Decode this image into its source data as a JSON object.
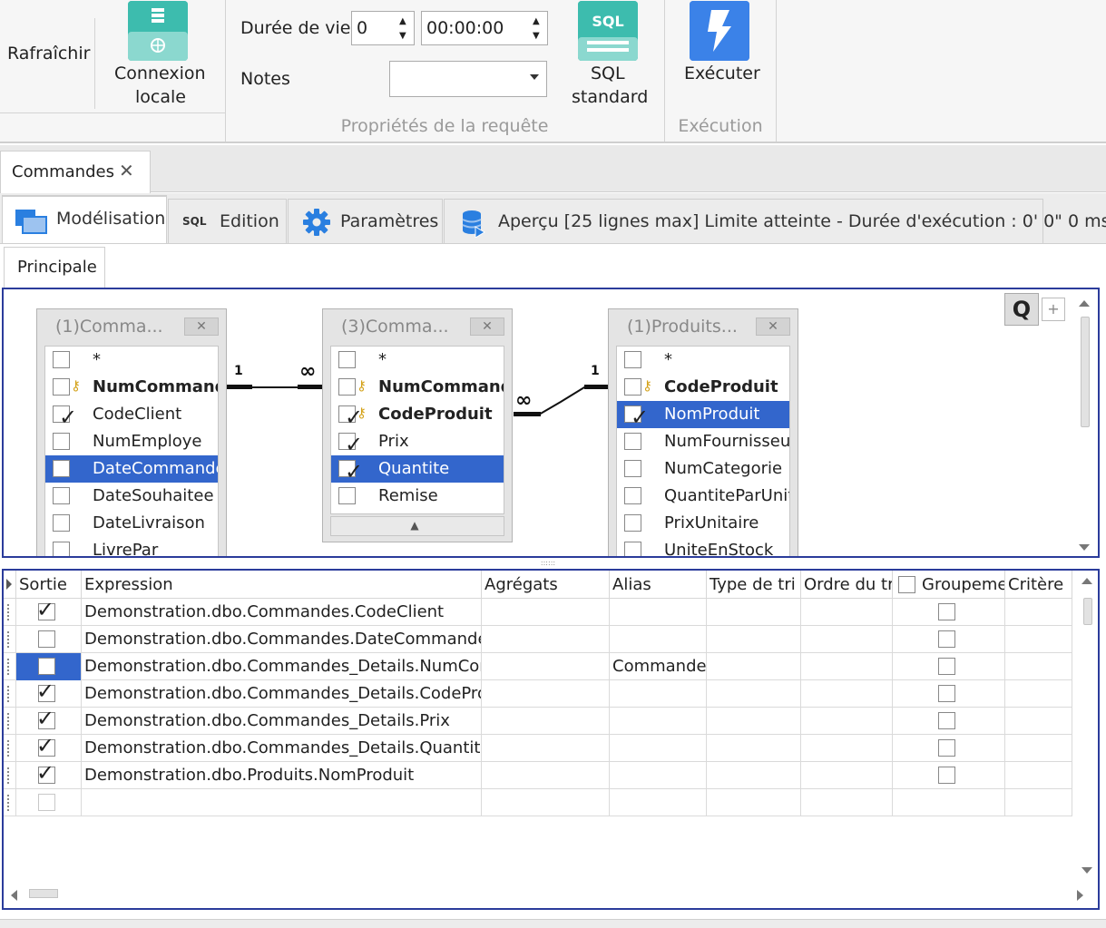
{
  "ribbon": {
    "refresh_label": "Rafraîchir",
    "local_conn_line1": "Connexion",
    "local_conn_line2": "locale",
    "lifetime_label": "Durée de vie",
    "lifetime_value": "0",
    "time_value": "00:00:00",
    "notes_label": "Notes",
    "notes_value": "",
    "sql_badge": "SQL",
    "sql_std_line1": "SQL",
    "sql_std_line2": "standard",
    "execute_label": "Exécuter",
    "group_props": "Propriétés de la requête",
    "group_exec": "Exécution"
  },
  "doc_tab": {
    "title": "Commandes",
    "close": "✕"
  },
  "tabs": [
    {
      "label": "Modélisation",
      "badge": ""
    },
    {
      "label": "Edition",
      "badge": "SQL"
    },
    {
      "label": "Paramètres",
      "badge": ""
    },
    {
      "label": "Aperçu [25 lignes max] Limite atteinte - Durée d'exécution : 0' 0\" 0 ms",
      "badge": ""
    }
  ],
  "subtab": "Principale",
  "diagram": {
    "q_label": "Q",
    "plus_label": "+",
    "grip": "::::::",
    "relations": [
      {
        "left": "1",
        "right": "∞"
      },
      {
        "left": "∞",
        "right": "1"
      }
    ],
    "tables": [
      {
        "name": "(1)Comma...",
        "fields": [
          {
            "name": "*",
            "checked": false,
            "key": false,
            "bold": false,
            "selected": false
          },
          {
            "name": "NumCommande",
            "checked": false,
            "key": true,
            "bold": true,
            "selected": false
          },
          {
            "name": "CodeClient",
            "checked": true,
            "key": false,
            "bold": false,
            "selected": false
          },
          {
            "name": "NumEmploye",
            "checked": false,
            "key": false,
            "bold": false,
            "selected": false
          },
          {
            "name": "DateCommande",
            "checked": false,
            "key": false,
            "bold": false,
            "selected": true
          },
          {
            "name": "DateSouhaitee",
            "checked": false,
            "key": false,
            "bold": false,
            "selected": false
          },
          {
            "name": "DateLivraison",
            "checked": false,
            "key": false,
            "bold": false,
            "selected": false
          },
          {
            "name": "LivrePar",
            "checked": false,
            "key": false,
            "bold": false,
            "selected": false
          }
        ]
      },
      {
        "name": "(3)Comma...",
        "fields": [
          {
            "name": "*",
            "checked": false,
            "key": false,
            "bold": false,
            "selected": false
          },
          {
            "name": "NumCommande",
            "checked": false,
            "key": true,
            "bold": true,
            "selected": false
          },
          {
            "name": "CodeProduit",
            "checked": true,
            "key": true,
            "bold": true,
            "selected": false
          },
          {
            "name": "Prix",
            "checked": true,
            "key": false,
            "bold": false,
            "selected": false
          },
          {
            "name": "Quantite",
            "checked": true,
            "key": false,
            "bold": false,
            "selected": true
          },
          {
            "name": "Remise",
            "checked": false,
            "key": false,
            "bold": false,
            "selected": false
          }
        ]
      },
      {
        "name": "(1)Produits...",
        "fields": [
          {
            "name": "*",
            "checked": false,
            "key": false,
            "bold": false,
            "selected": false
          },
          {
            "name": "CodeProduit",
            "checked": false,
            "key": true,
            "bold": true,
            "selected": false
          },
          {
            "name": "NomProduit",
            "checked": true,
            "key": false,
            "bold": false,
            "selected": true
          },
          {
            "name": "NumFournisseur",
            "checked": false,
            "key": false,
            "bold": false,
            "selected": false
          },
          {
            "name": "NumCategorie",
            "checked": false,
            "key": false,
            "bold": false,
            "selected": false
          },
          {
            "name": "QuantiteParUnite",
            "checked": false,
            "key": false,
            "bold": false,
            "selected": false
          },
          {
            "name": "PrixUnitaire",
            "checked": false,
            "key": false,
            "bold": false,
            "selected": false
          },
          {
            "name": "UniteEnStock",
            "checked": false,
            "key": false,
            "bold": false,
            "selected": false
          }
        ]
      }
    ]
  },
  "grid": {
    "columns": [
      "Sortie",
      "Expression",
      "Agrégats",
      "Alias",
      "Type de tri",
      "Ordre du tri",
      "Groupement",
      "Critère"
    ],
    "rows": [
      {
        "output": true,
        "expression": "Demonstration.dbo.Commandes.CodeClient",
        "alias": "",
        "selected": false
      },
      {
        "output": false,
        "expression": "Demonstration.dbo.Commandes.DateCommande",
        "alias": "",
        "selected": false
      },
      {
        "output": false,
        "expression": "Demonstration.dbo.Commandes_Details.NumCommande",
        "alias": "Commande",
        "selected": true
      },
      {
        "output": true,
        "expression": "Demonstration.dbo.Commandes_Details.CodeProduit",
        "alias": "",
        "selected": false
      },
      {
        "output": true,
        "expression": "Demonstration.dbo.Commandes_Details.Prix",
        "alias": "",
        "selected": false
      },
      {
        "output": true,
        "expression": "Demonstration.dbo.Commandes_Details.Quantite",
        "alias": "",
        "selected": false
      },
      {
        "output": true,
        "expression": "Demonstration.dbo.Produits.NomProduit",
        "alias": "",
        "selected": false
      },
      {
        "output": false,
        "expression": "",
        "alias": "",
        "selected": false,
        "empty": true
      }
    ]
  },
  "colors": {
    "accent": "#3366cc",
    "border_focus": "#2b3c9b",
    "teal": "#3dbcae",
    "blue_icon": "#3b82e8"
  }
}
